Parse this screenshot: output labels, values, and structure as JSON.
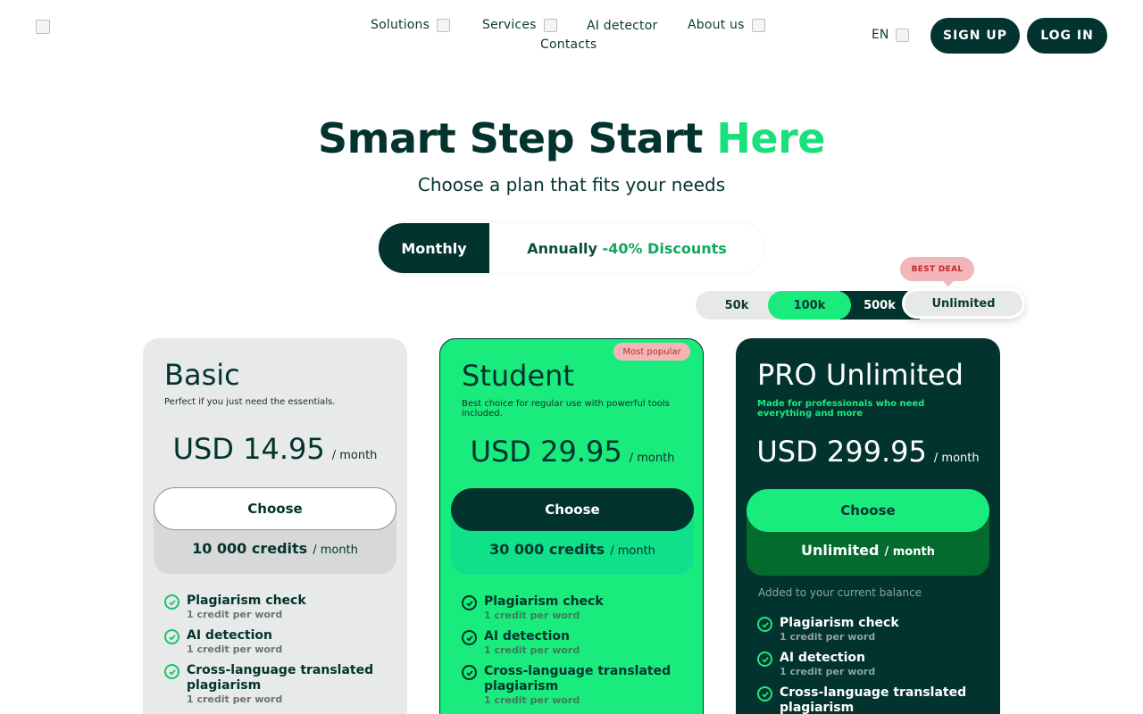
{
  "header": {
    "nav": [
      {
        "label": "Solutions"
      },
      {
        "label": "Services"
      },
      {
        "label": "AI detector"
      },
      {
        "label": "About us"
      },
      {
        "label": "Contacts"
      }
    ],
    "lang": "EN",
    "signup": "SIGN UP",
    "login": "LOG IN"
  },
  "hero": {
    "title_main": "Smart Step Start ",
    "title_accent": "Here",
    "subtitle": "Choose a plan that fits your needs"
  },
  "billing": {
    "monthly": "Monthly",
    "annual_prefix": "Annually ",
    "annual_discount": "-40% Discounts",
    "selected": "Monthly"
  },
  "tiers": {
    "badge": "BEST DEAL",
    "options": [
      "50k",
      "100k",
      "500k",
      "Unlimited"
    ],
    "selected": "Unlimited"
  },
  "plans": [
    {
      "name": "Basic",
      "description": "Perfect if you just need the essentials.",
      "price": "USD 14.95",
      "per": "/ month",
      "cta": "Choose",
      "credits": "10 000 credits",
      "credits_per": "/ month",
      "features": [
        {
          "title": "Plagiarism check",
          "sub": "1 credit per word"
        },
        {
          "title": "AI detection",
          "sub": "1 credit per word"
        },
        {
          "title": "Cross-language translated plagiarism",
          "sub": "1 credit per word"
        }
      ]
    },
    {
      "name": "Student",
      "badge": "Most popular",
      "description": "Best choice for regular use with powerful tools included.",
      "price": "USD 29.95",
      "per": "/ month",
      "cta": "Choose",
      "credits": "30 000 credits",
      "credits_per": "/ month",
      "features": [
        {
          "title": "Plagiarism check",
          "sub": "1 credit per word"
        },
        {
          "title": "AI detection",
          "sub": "1 credit per word"
        },
        {
          "title": "Cross-language translated plagiarism",
          "sub": "1 credit per word"
        }
      ]
    },
    {
      "name": "PRO Unlimited",
      "description": "Made for professionals who need everything and more",
      "price": "USD 299.95",
      "per": "/ month",
      "cta": "Choose",
      "credits": "Unlimited",
      "credits_per": "/ month",
      "note": "Added to your current balance",
      "features": [
        {
          "title": "Plagiarism check",
          "sub": "1 credit per word"
        },
        {
          "title": "AI detection",
          "sub": "1 credit per word"
        },
        {
          "title": "Cross-language translated plagiarism",
          "sub": ""
        }
      ]
    }
  ],
  "colors": {
    "primary_dark": "#03332e",
    "accent_green": "#19ec7c",
    "badge_pink": "#f3b6b8"
  }
}
